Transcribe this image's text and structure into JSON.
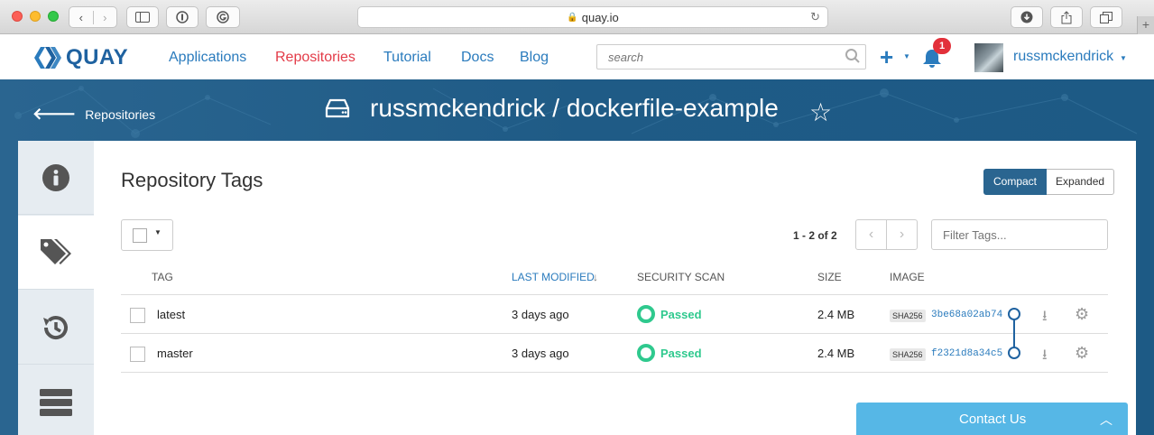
{
  "browser": {
    "url": "quay.io",
    "nav_back": "‹",
    "nav_forward": "›"
  },
  "header": {
    "logo_text": "QUAY",
    "nav": [
      "Applications",
      "Repositories",
      "Tutorial",
      "Docs",
      "Blog"
    ],
    "active_nav": "Repositories",
    "search_placeholder": "search",
    "notification_count": "1",
    "username": "russmckendrick"
  },
  "banner": {
    "back_label": "Repositories",
    "repo_title": "russmckendrick / dockerfile-example"
  },
  "sidebar": {
    "tabs": [
      "info",
      "tags",
      "history",
      "builds"
    ],
    "active": "tags"
  },
  "main": {
    "title": "Repository Tags",
    "view_modes": [
      "Compact",
      "Expanded"
    ],
    "active_view": "Compact",
    "pager_text": "1 - 2 of 2",
    "filter_placeholder": "Filter Tags...",
    "columns": [
      "TAG",
      "LAST MODIFIED",
      "SECURITY SCAN",
      "SIZE",
      "IMAGE"
    ],
    "sorted_column": "LAST MODIFIED",
    "sha_label": "SHA256",
    "rows": [
      {
        "tag": "latest",
        "modified": "3 days ago",
        "scan": "Passed",
        "size": "2.4 MB",
        "image": "3be68a02ab74"
      },
      {
        "tag": "master",
        "modified": "3 days ago",
        "scan": "Passed",
        "size": "2.4 MB",
        "image": "f2321d8a34c5"
      }
    ]
  },
  "contact": {
    "label": "Contact Us"
  },
  "colors": {
    "brand": "#1f62a0",
    "link": "#2a7bbd",
    "active_nav": "#e33b48",
    "banner": "#1f5b86",
    "passed": "#2fc98e",
    "contact": "#56b7e6"
  }
}
